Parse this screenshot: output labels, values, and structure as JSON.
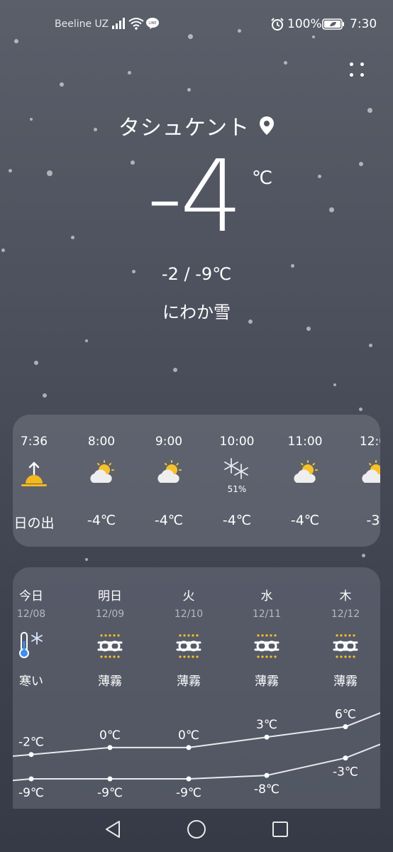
{
  "status_bar": {
    "carrier": "Beeline UZ",
    "battery": "100%",
    "time": "7:30",
    "icons": [
      "signal-icon",
      "wifi-icon",
      "line-app-icon",
      "alarm-icon",
      "battery-icon"
    ]
  },
  "current": {
    "city": "タシュケント",
    "temp": "-4",
    "unit": "℃",
    "range": "-2 / -9℃",
    "condition": "にわか雪"
  },
  "hourly": [
    {
      "time": "7:36",
      "icon": "sunrise-icon",
      "label": "日の出",
      "pop": ""
    },
    {
      "time": "8:00",
      "icon": "partly-cloudy-icon",
      "label": "-4℃",
      "pop": ""
    },
    {
      "time": "9:00",
      "icon": "partly-cloudy-icon",
      "label": "-4℃",
      "pop": ""
    },
    {
      "time": "10:00",
      "icon": "snow-icon",
      "label": "-4℃",
      "pop": "51%"
    },
    {
      "time": "11:00",
      "icon": "partly-cloudy-icon",
      "label": "-4℃",
      "pop": ""
    },
    {
      "time": "12:0",
      "icon": "partly-cloudy-icon",
      "label": "-3",
      "pop": ""
    }
  ],
  "daily": [
    {
      "day": "今日",
      "date": "12/08",
      "icon": "cold-thermometer-icon",
      "desc": "寒い",
      "high": "-2℃",
      "low": "-9℃"
    },
    {
      "day": "明日",
      "date": "12/09",
      "icon": "haze-icon",
      "desc": "薄霧",
      "high": "0℃",
      "low": "-9℃"
    },
    {
      "day": "火",
      "date": "12/10",
      "icon": "haze-icon",
      "desc": "薄霧",
      "high": "0℃",
      "low": "-9℃"
    },
    {
      "day": "水",
      "date": "12/11",
      "icon": "haze-icon",
      "desc": "薄霧",
      "high": "3℃",
      "low": "-8℃"
    },
    {
      "day": "木",
      "date": "12/12",
      "icon": "haze-icon",
      "desc": "薄霧",
      "high": "6℃",
      "low": "-3℃"
    }
  ],
  "nav_bar": {
    "icons": [
      "back-icon",
      "home-icon",
      "recents-icon"
    ]
  }
}
